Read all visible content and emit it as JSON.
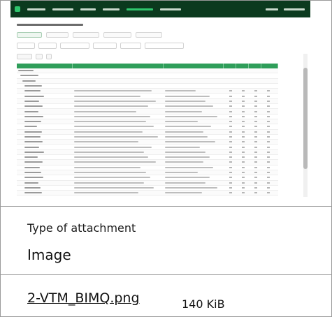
{
  "attachment": {
    "type_label": "Type of attachment",
    "type_value": "Image",
    "file_name": "2-VTM_BIMQ.png",
    "file_size": "140 KiB"
  },
  "thumbnail": {
    "nav_color": "#0b3a1e",
    "accent_color": "#2fc66d",
    "grid_header_color": "#2f9e5a"
  }
}
